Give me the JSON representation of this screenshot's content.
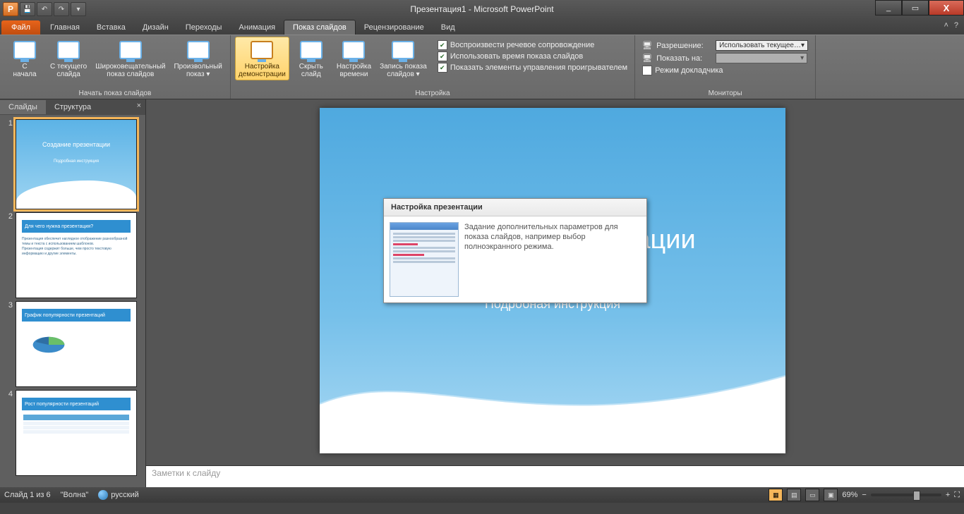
{
  "title": "Презентация1 - Microsoft PowerPoint",
  "qat": {
    "app_letter": "P",
    "save": "save",
    "undo": "undo",
    "redo": "redo"
  },
  "win": {
    "min": "_",
    "max": "▭",
    "close": "X"
  },
  "tabs": {
    "file": "Файл",
    "items": [
      "Главная",
      "Вставка",
      "Дизайн",
      "Переходы",
      "Анимация",
      "Показ слайдов",
      "Рецензирование",
      "Вид"
    ],
    "active_index": 5
  },
  "ribbon": {
    "group1": {
      "label": "Начать показ слайдов",
      "from_beginning": "С\nначала",
      "from_current": "С текущего\nслайда",
      "broadcast": "Широковещательный\nпоказ слайдов",
      "custom": "Произвольный\nпоказ ▾"
    },
    "group2": {
      "label": "Настройка",
      "setup": "Настройка\nдемонстрации",
      "hide": "Скрыть\nслайд",
      "rehearse": "Настройка\nвремени",
      "record": "Запись показа\nслайдов ▾",
      "chk1": "Воспроизвести речевое сопровождение",
      "chk2": "Использовать время показа слайдов",
      "chk3": "Показать элементы управления проигрывателем"
    },
    "group3": {
      "label": "Мониторы",
      "resolution_lbl": "Разрешение:",
      "resolution_val": "Использовать текущее…",
      "show_on_lbl": "Показать на:",
      "show_on_val": "",
      "presenter": "Режим докладчика"
    }
  },
  "tooltip": {
    "title": "Настройка презентации",
    "body": "Задание дополнительных параметров для показа слайдов, например выбор полноэкранного режима."
  },
  "panel": {
    "tab_slides": "Слайды",
    "tab_outline": "Структура",
    "close": "×",
    "thumbs": [
      {
        "n": "1",
        "title": "Создание презентации",
        "sub": "Подробная инструкция"
      },
      {
        "n": "2",
        "bar": "Для чего нужна презентация?",
        "body": "Презентация обеспечит наглядное отображение разнообразной темы и текста с использованием шаблонов.\nПрезентация содержит больше, чем просто текстовую информацию и другие элементы."
      },
      {
        "n": "3",
        "bar": "График популярности презентаций"
      },
      {
        "n": "4",
        "bar": "Рост популярности презентаций"
      }
    ]
  },
  "slide": {
    "title": "Создание презентации",
    "subtitle": "Подробная инструкция"
  },
  "notes_placeholder": "Заметки к слайду",
  "status": {
    "slide_info": "Слайд 1 из 6",
    "theme": "\"Волна\"",
    "lang": "русский",
    "zoom": "69%"
  }
}
